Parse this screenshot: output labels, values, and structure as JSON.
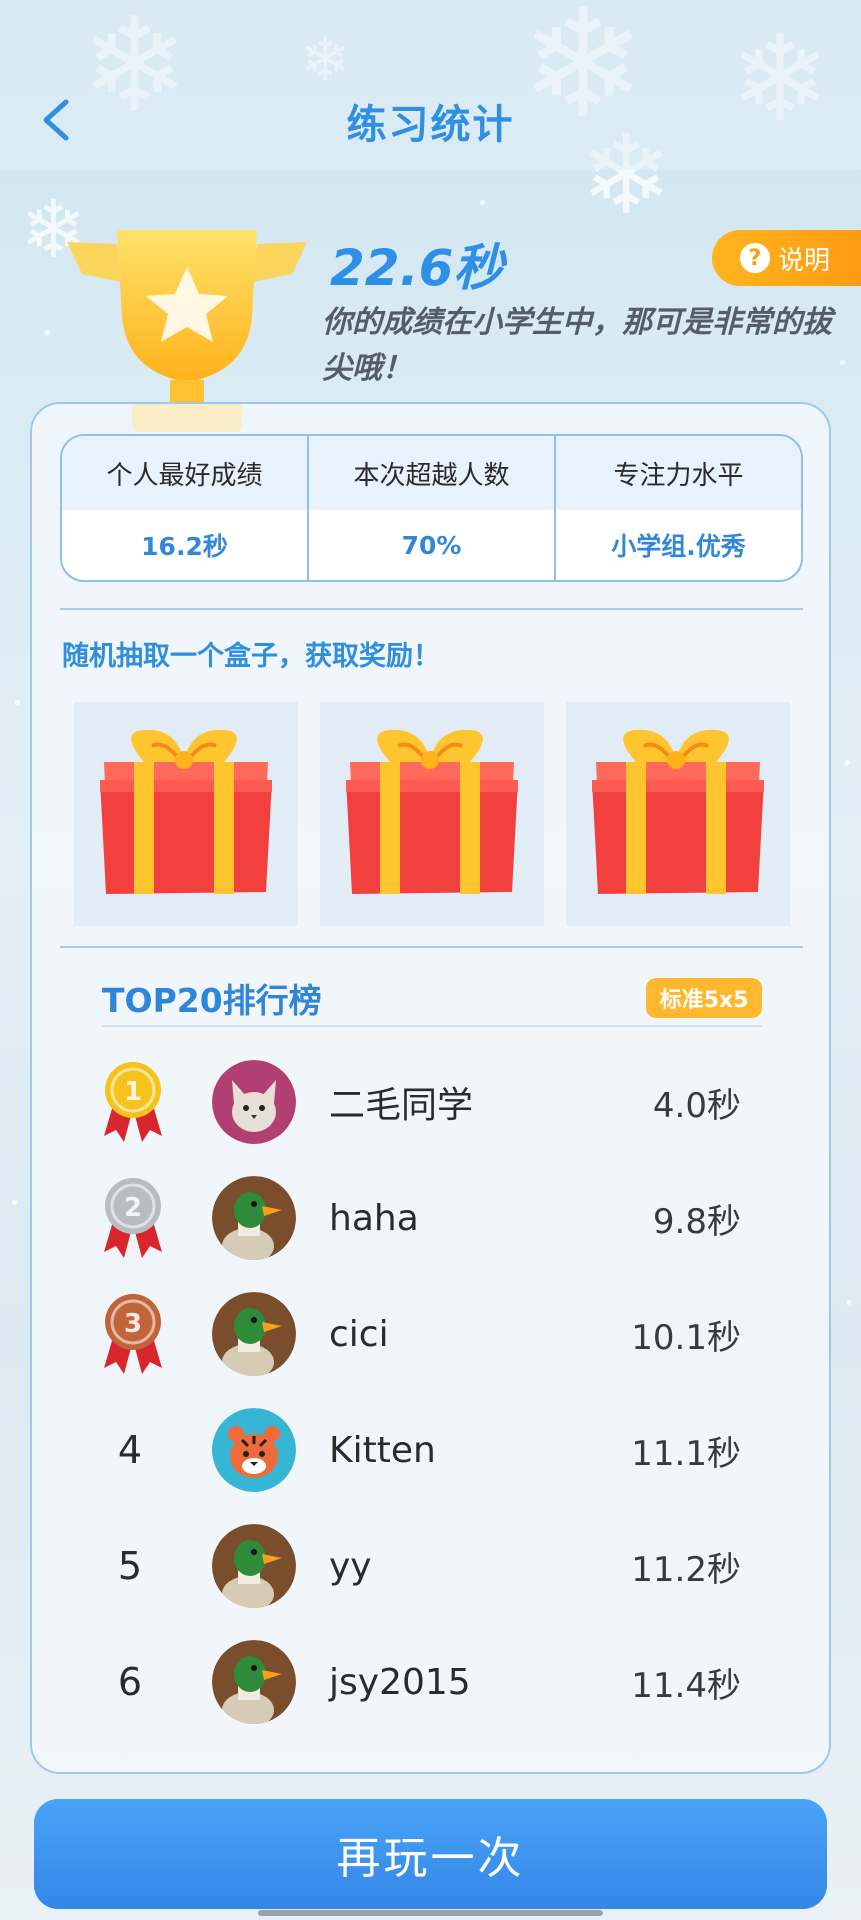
{
  "header": {
    "title": "练习统计"
  },
  "result": {
    "score": "22.6秒",
    "comment": "你的成绩在小学生中，那可是非常的拔尖哦！",
    "help_label": "说明"
  },
  "stats": [
    {
      "label": "个人最好成绩",
      "value": "16.2秒"
    },
    {
      "label": "本次超越人数",
      "value": "70%"
    },
    {
      "label": "专注力水平",
      "value": "小学组.优秀"
    }
  ],
  "prize": {
    "hint": "随机抽取一个盒子，获取奖励！",
    "box_count": 3
  },
  "ranking": {
    "title": "TOP20排行榜",
    "mode_badge": "标准5x5",
    "rows": [
      {
        "rank": "1",
        "name": "二毛同学",
        "time": "4.0秒",
        "avatar": "cat-avatar",
        "medal": "gold"
      },
      {
        "rank": "2",
        "name": "haha",
        "time": "9.8秒",
        "avatar": "duck-avatar",
        "medal": "silver"
      },
      {
        "rank": "3",
        "name": "cici",
        "time": "10.1秒",
        "avatar": "duck-avatar",
        "medal": "bronze"
      },
      {
        "rank": "4",
        "name": "Kitten",
        "time": "11.1秒",
        "avatar": "tiger-avatar",
        "medal": ""
      },
      {
        "rank": "5",
        "name": "yy",
        "time": "11.2秒",
        "avatar": "duck-avatar",
        "medal": ""
      },
      {
        "rank": "6",
        "name": "jsy2015",
        "time": "11.4秒",
        "avatar": "duck-avatar",
        "medal": ""
      }
    ]
  },
  "footer": {
    "play_again_label": "再玩一次"
  },
  "colors": {
    "accent": "#2f8fe0",
    "help_orange": "#ffa41a",
    "button_blue": "#3d92ee",
    "gold": "#f6c21c",
    "silver": "#b9bcc2",
    "bronze": "#c2643a",
    "ribbon_red": "#d8262c"
  }
}
